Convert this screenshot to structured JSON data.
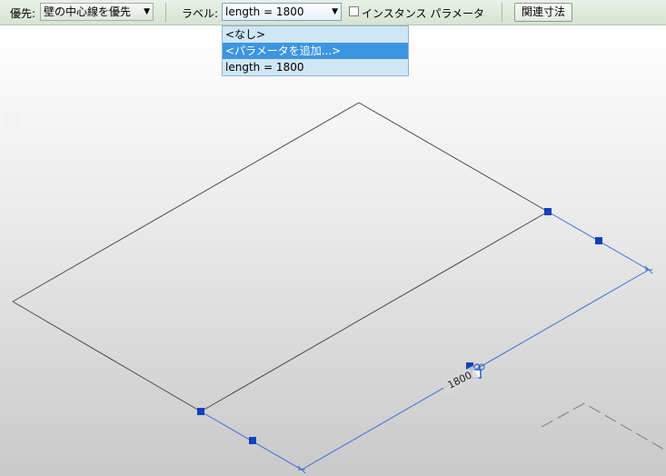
{
  "toolbar": {
    "priority_label": "優先:",
    "priority_value": "壁の中心線を優先",
    "label_label": "ラベル:",
    "label_value": "length = 1800",
    "instance_param_label": "インスタンス パラメータ",
    "related_dim_button": "関連寸法"
  },
  "label_dropdown": {
    "options": [
      "<なし>",
      "<パラメータを追加...>",
      "length = 1800"
    ],
    "highlighted": "<パラメータを追加...>"
  },
  "dimension": {
    "value": "1800"
  },
  "colors": {
    "toolbar_bg": "#dde8d9",
    "dropdown_bg": "#cfe6f6",
    "dropdown_highlight": "#3d95e0",
    "dimension_line": "#3b6fd8",
    "grip": "#1241b8",
    "model_edge": "#4a4a4a"
  },
  "icons": [
    "combo-arrow-icon",
    "lock-icon",
    "flip-control-icon"
  ]
}
